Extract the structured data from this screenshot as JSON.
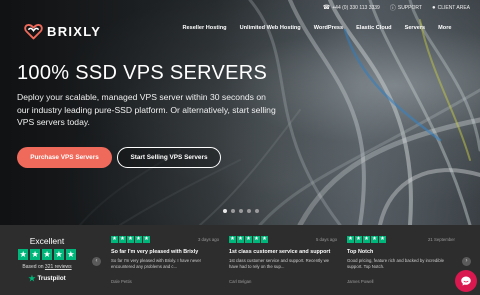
{
  "topbar": {
    "phone": "+44 (0) 330 113 3339",
    "phone_icon": "phone-icon",
    "support": "SUPPORT",
    "support_icon": "question-icon",
    "client_area": "CLIENT AREA",
    "client_icon": "user-icon"
  },
  "brand": {
    "name": "BRIXLY",
    "logo_color": "#ef6a5b"
  },
  "nav": [
    "Reseller Hosting",
    "Unlimited Web Hosting",
    "WordPress",
    "Elastic Cloud",
    "Servers",
    "More"
  ],
  "hero": {
    "headline": "100% SSD VPS SERVERS",
    "subtext": "Deploy your scalable, managed VPS server within 30 seconds on our industry leading pure-SSD platform. Or alternatively, start selling VPS servers today.",
    "primary_button": "Purchase VPS Servers",
    "secondary_button": "Start Selling VPS Servers",
    "slides": 5,
    "active_slide": 1
  },
  "trustpilot": {
    "rating_word": "Excellent",
    "based_on_prefix": "Based on",
    "review_count_link": "321 reviews",
    "brand": "Trustpilot",
    "star_color": "#00b67a",
    "reviews": [
      {
        "stars": 5,
        "date": "3 days ago",
        "title": "So far I'm very pleased with Brixly",
        "body": "So far I'm very pleased with Brixly. I have never encountered any problems and c...",
        "author": "Dale Pettis"
      },
      {
        "stars": 5,
        "date": "5 days ago",
        "title": "1st class customer service and support",
        "body": "1st class customer service and support. Recently we have had to rely on the sup...",
        "author": "Carl Belgan"
      },
      {
        "stars": 5,
        "date": "21 September",
        "title": "Top Notch",
        "body": "Good pricing, feature rich and backed by incredible support. Top Notch.",
        "author": "James Powell"
      }
    ]
  },
  "chat": {
    "icon": "chat-bubble-icon",
    "color": "#d8184f"
  }
}
